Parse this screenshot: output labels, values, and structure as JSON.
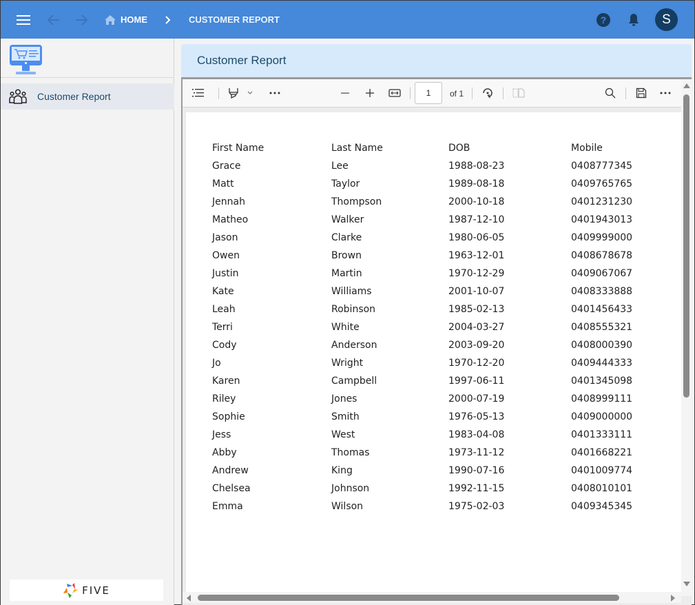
{
  "topbar": {
    "home_label": "HOME",
    "current_label": "CUSTOMER REPORT",
    "avatar_initial": "S",
    "icons": [
      "menu-icon",
      "arrow-left-icon",
      "arrow-right-icon",
      "home-icon",
      "chevron-right-icon",
      "help-icon",
      "bell-icon"
    ]
  },
  "sidebar": {
    "items": [
      {
        "label": "Customer Report",
        "icon": "people-icon",
        "selected": true
      }
    ],
    "footer_logo": "FIVE"
  },
  "panel": {
    "title": "Customer Report"
  },
  "viewer_toolbar": {
    "page_current": "1",
    "page_total_label": "of 1",
    "tools": [
      "contents-icon",
      "highlight-icon",
      "chevron-down-icon",
      "more-icon",
      "zoom-out-icon",
      "zoom-in-icon",
      "fit-width-icon",
      "rotate-icon",
      "two-page-icon",
      "search-icon",
      "save-icon",
      "more-options-icon"
    ]
  },
  "report": {
    "columns": [
      "First Name",
      "Last Name",
      "DOB",
      "Mobile"
    ],
    "rows": [
      [
        "Grace",
        "Lee",
        "1988-08-23",
        "0408777345"
      ],
      [
        "Matt",
        "Taylor",
        "1989-08-18",
        "0409765765"
      ],
      [
        "Jennah",
        "Thompson",
        "2000-10-18",
        "0401231230"
      ],
      [
        "Matheo",
        "Walker",
        "1987-12-10",
        "0401943013"
      ],
      [
        "Jason",
        "Clarke",
        "1980-06-05",
        "0409999000"
      ],
      [
        "Owen",
        "Brown",
        "1963-12-01",
        "0408678678"
      ],
      [
        "Justin",
        "Martin",
        "1970-12-29",
        "0409067067"
      ],
      [
        "Kate",
        "Williams",
        "2001-10-07",
        "0408333888"
      ],
      [
        "Leah",
        "Robinson",
        "1985-02-13",
        "0401456433"
      ],
      [
        "Terri",
        "White",
        "2004-03-27",
        "0408555321"
      ],
      [
        "Cody",
        "Anderson",
        "2003-09-20",
        "0408000390"
      ],
      [
        "Jo",
        "Wright",
        "1970-12-20",
        "0409444333"
      ],
      [
        "Karen",
        "Campbell",
        "1997-06-11",
        "0401345098"
      ],
      [
        "Riley",
        "Jones",
        "2000-07-19",
        "0408999111"
      ],
      [
        "Sophie",
        "Smith",
        "1976-05-13",
        "0409000000"
      ],
      [
        "Jess",
        "West",
        "1983-04-08",
        "0401333111"
      ],
      [
        "Abby",
        "Thomas",
        "1973-11-12",
        "0401668221"
      ],
      [
        "Andrew",
        "King",
        "1990-07-16",
        "0401009774"
      ],
      [
        "Chelsea",
        "Johnson",
        "1992-11-15",
        "0408010101"
      ],
      [
        "Emma",
        "Wilson",
        "1975-02-03",
        "0409345345"
      ]
    ]
  },
  "colors": {
    "topbar": "#4688d9",
    "avatar": "#143d63",
    "panel_header": "#d7eafc",
    "title_text": "#1c4a6c"
  }
}
